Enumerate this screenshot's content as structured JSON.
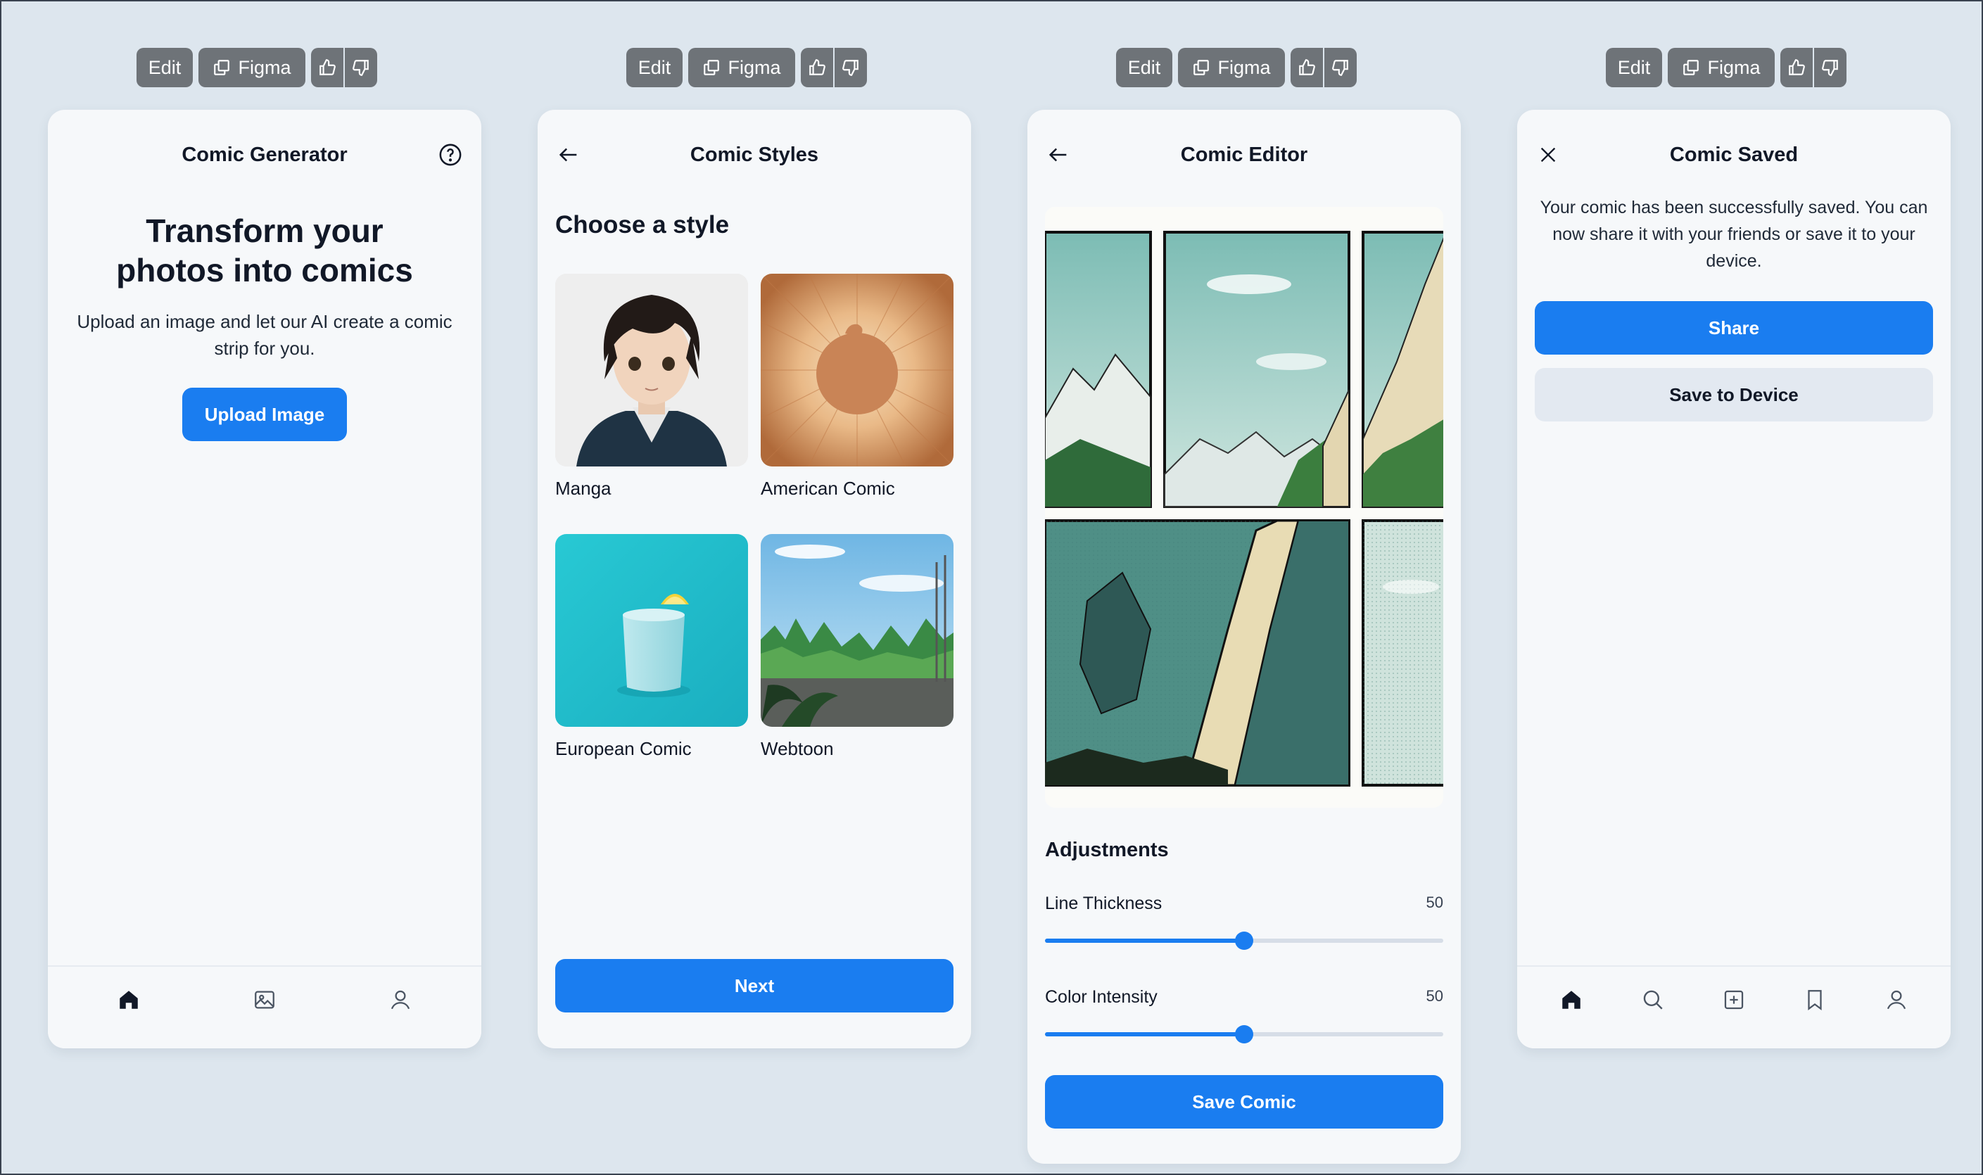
{
  "toolbar": {
    "edit": "Edit",
    "figma": "Figma"
  },
  "screen1": {
    "title": "Comic Generator",
    "heading": "Transform your photos into comics",
    "description": "Upload an image and let our AI create a comic strip for you.",
    "upload_button": "Upload Image",
    "nav": [
      "home-icon",
      "image-icon",
      "profile-icon"
    ]
  },
  "screen2": {
    "title": "Comic Styles",
    "subtitle": "Choose a style",
    "styles": [
      {
        "label": "Manga",
        "icon": "manga-portrait-image"
      },
      {
        "label": "American Comic",
        "icon": "sunburst-image"
      },
      {
        "label": "European Comic",
        "icon": "cup-image"
      },
      {
        "label": "Webtoon",
        "icon": "forest-landscape-image"
      }
    ],
    "next_button": "Next"
  },
  "screen3": {
    "title": "Comic Editor",
    "adjustments_title": "Adjustments",
    "sliders": [
      {
        "label": "Line Thickness",
        "value": "50",
        "fraction": 0.5
      },
      {
        "label": "Color Intensity",
        "value": "50",
        "fraction": 0.5
      }
    ],
    "save_button": "Save Comic"
  },
  "screen4": {
    "title": "Comic Saved",
    "message": "Your comic has been successfully saved. You can now share it with your friends or save it to your device.",
    "share_button": "Share",
    "save_device_button": "Save to Device",
    "nav": [
      "home-icon",
      "search-icon",
      "add-icon",
      "bookmark-icon",
      "profile-icon"
    ]
  },
  "colors": {
    "primary": "#1a7df0",
    "background": "#dde6ee",
    "card": "#f6f8fa",
    "toolbar": "#6e7378"
  }
}
